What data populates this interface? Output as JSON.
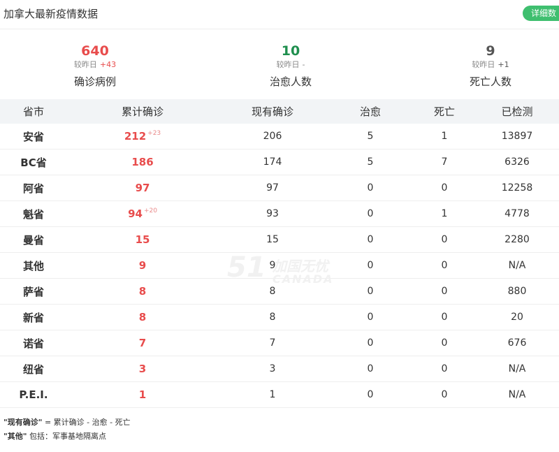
{
  "header": {
    "title": "加拿大最新疫情数据",
    "detail_label": "详细数"
  },
  "summary": {
    "confirmed": {
      "value": "640",
      "compare_label": "较昨日",
      "delta": "+43",
      "label": "确诊病例",
      "color": "#e84c4c"
    },
    "recovered": {
      "value": "10",
      "compare_label": "较昨日",
      "delta": "-",
      "label": "治愈人数",
      "color": "#1f8f4e"
    },
    "deaths": {
      "value": "9",
      "compare_label": "较昨日",
      "delta": "+1",
      "label": "死亡人数",
      "color": "#555555"
    }
  },
  "table": {
    "headers": [
      "省市",
      "累计确诊",
      "现有确诊",
      "治愈",
      "死亡",
      "已检测"
    ],
    "rows": [
      {
        "province": "安省",
        "cumulative": "212",
        "inc": "+23",
        "current": "206",
        "recovered": "5",
        "deaths": "1",
        "tested": "13897"
      },
      {
        "province": "BC省",
        "cumulative": "186",
        "inc": "",
        "current": "174",
        "recovered": "5",
        "deaths": "7",
        "tested": "6326"
      },
      {
        "province": "阿省",
        "cumulative": "97",
        "inc": "",
        "current": "97",
        "recovered": "0",
        "deaths": "0",
        "tested": "12258"
      },
      {
        "province": "魁省",
        "cumulative": "94",
        "inc": "+20",
        "current": "93",
        "recovered": "0",
        "deaths": "1",
        "tested": "4778"
      },
      {
        "province": "曼省",
        "cumulative": "15",
        "inc": "",
        "current": "15",
        "recovered": "0",
        "deaths": "0",
        "tested": "2280"
      },
      {
        "province": "其他",
        "cumulative": "9",
        "inc": "",
        "current": "9",
        "recovered": "0",
        "deaths": "0",
        "tested": "N/A"
      },
      {
        "province": "萨省",
        "cumulative": "8",
        "inc": "",
        "current": "8",
        "recovered": "0",
        "deaths": "0",
        "tested": "880"
      },
      {
        "province": "新省",
        "cumulative": "8",
        "inc": "",
        "current": "8",
        "recovered": "0",
        "deaths": "0",
        "tested": "20"
      },
      {
        "province": "诺省",
        "cumulative": "7",
        "inc": "",
        "current": "7",
        "recovered": "0",
        "deaths": "0",
        "tested": "676"
      },
      {
        "province": "纽省",
        "cumulative": "3",
        "inc": "",
        "current": "3",
        "recovered": "0",
        "deaths": "0",
        "tested": "N/A"
      },
      {
        "province": "P.E.I.",
        "cumulative": "1",
        "inc": "",
        "current": "1",
        "recovered": "0",
        "deaths": "0",
        "tested": "N/A"
      }
    ]
  },
  "notes": {
    "line1_term": "\"现有确诊\"",
    "line1_text": " = 累计确诊 - 治愈 - 死亡",
    "line2_term": "\"其他\"",
    "line2_text": " 包括：军事基地隔离点"
  },
  "watermark": {
    "number": "51",
    "cn": "加国无忧",
    "en": "CANADA"
  }
}
